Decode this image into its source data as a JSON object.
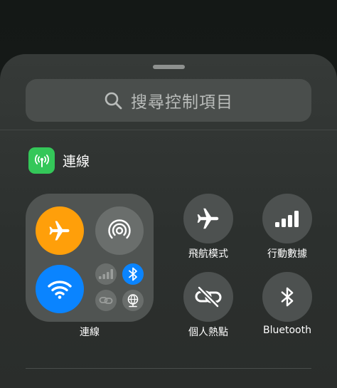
{
  "search": {
    "placeholder": "搜尋控制項目"
  },
  "section": {
    "title": "連線",
    "icon": "antenna-icon"
  },
  "module": {
    "label": "連線",
    "buttons": {
      "airplane": {
        "icon": "airplane-icon",
        "color": "#ff9f0a",
        "active": true
      },
      "airdrop": {
        "icon": "airdrop-icon",
        "active": false
      },
      "wifi": {
        "icon": "wifi-icon",
        "color": "#0a84ff",
        "active": true
      },
      "cellular": {
        "icon": "cellular-icon",
        "active": false
      },
      "bluetooth": {
        "icon": "bluetooth-icon",
        "color": "#0a84ff",
        "active": true
      },
      "hotspot": {
        "icon": "link-icon",
        "active": false
      },
      "vpn": {
        "icon": "globe-network-icon",
        "active": false
      }
    }
  },
  "tiles": [
    {
      "label": "飛航模式",
      "icon": "airplane-icon"
    },
    {
      "label": "行動數據",
      "icon": "cellular-icon"
    },
    {
      "label": "個人熱點",
      "icon": "hotspot-icon"
    },
    {
      "label": "Bluetooth",
      "icon": "bluetooth-icon"
    }
  ],
  "colors": {
    "accent_orange": "#ff9f0a",
    "accent_blue": "#0a84ff",
    "accent_green": "#34c759"
  }
}
